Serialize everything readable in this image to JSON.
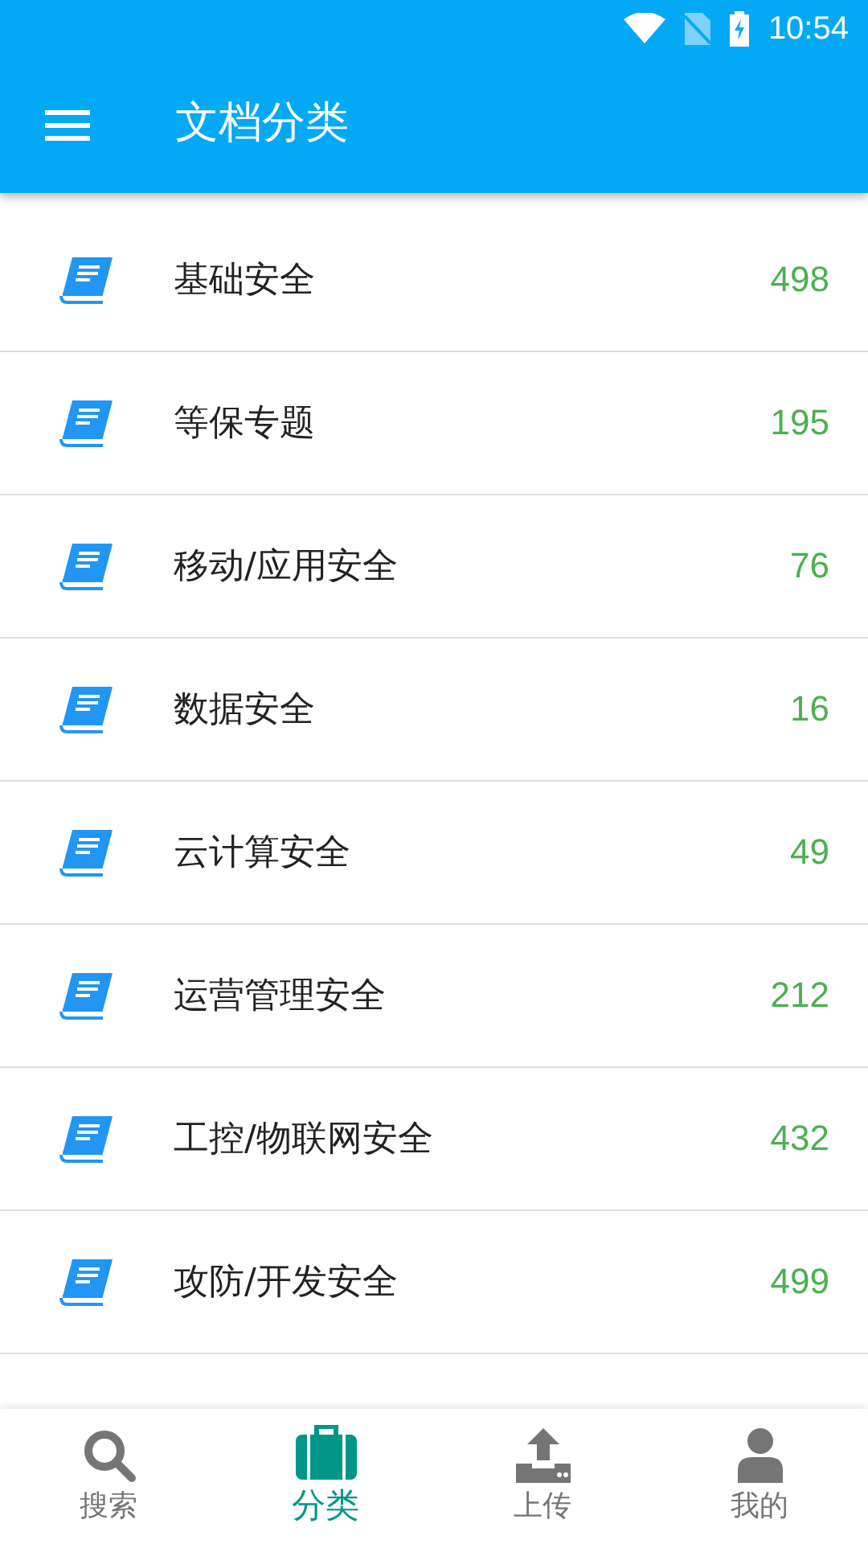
{
  "status_bar": {
    "time": "10:54"
  },
  "app_bar": {
    "title": "文档分类"
  },
  "categories": [
    {
      "name": "基础安全",
      "count": "498"
    },
    {
      "name": "等保专题",
      "count": "195"
    },
    {
      "name": "移动/应用安全",
      "count": "76"
    },
    {
      "name": "数据安全",
      "count": "16"
    },
    {
      "name": "云计算安全",
      "count": "49"
    },
    {
      "name": "运营管理安全",
      "count": "212"
    },
    {
      "name": "工控/物联网安全",
      "count": "432"
    },
    {
      "name": "攻防/开发安全",
      "count": "499"
    }
  ],
  "bottom_nav": [
    {
      "kind": "search",
      "label": "搜索",
      "selected": false
    },
    {
      "kind": "category",
      "label": "分类",
      "selected": true
    },
    {
      "kind": "upload",
      "label": "上传",
      "selected": false
    },
    {
      "kind": "profile",
      "label": "我的",
      "selected": false
    }
  ]
}
